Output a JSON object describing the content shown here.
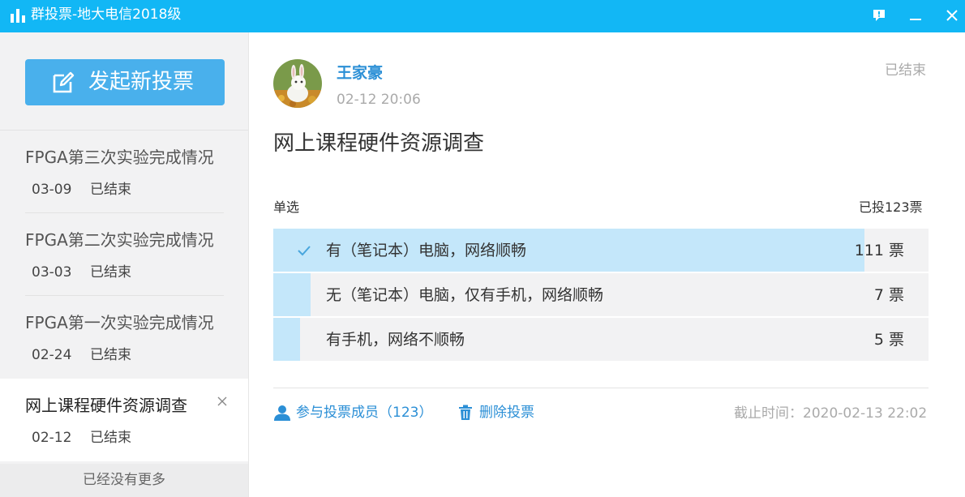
{
  "window": {
    "title": "群投票-地大电信2018级",
    "accent_color": "#12b7f5",
    "icons": [
      "bar-chart-icon",
      "feedback-icon",
      "minimize-icon",
      "close-icon"
    ]
  },
  "sidebar": {
    "new_vote_label": "发起新投票",
    "items": [
      {
        "title": "FPGA第三次实验完成情况",
        "date": "03-09",
        "status": "已结束"
      },
      {
        "title": "FPGA第二次实验完成情况",
        "date": "03-03",
        "status": "已结束"
      },
      {
        "title": "FPGA第一次实验完成情况",
        "date": "02-24",
        "status": "已结束"
      },
      {
        "title": "网上课程硬件资源调查",
        "date": "02-12",
        "status": "已结束",
        "selected": true
      }
    ],
    "no_more_text": "已经没有更多"
  },
  "poll": {
    "author": "王家豪",
    "post_time": "02-12 20:06",
    "status": "已结束",
    "title": "网上课程硬件资源调查",
    "type": "单选",
    "total_text": "已投123票",
    "options": [
      {
        "label": "有（笔记本）电脑，网络顺畅",
        "count_text": "111 票",
        "votes": 111,
        "checked": true
      },
      {
        "label": "无（笔记本）电脑，仅有手机，网络顺畅",
        "count_text": "7 票",
        "votes": 7,
        "checked": false
      },
      {
        "label": "有手机，网络不顺畅",
        "count_text": "5 票",
        "votes": 5,
        "checked": false
      }
    ],
    "total_votes": 123,
    "fill_color": "#c4e7fa",
    "members_link": "参与投票成员（123）",
    "delete_link": "删除投票",
    "deadline": "截止时间：2020-02-13 22:02"
  }
}
